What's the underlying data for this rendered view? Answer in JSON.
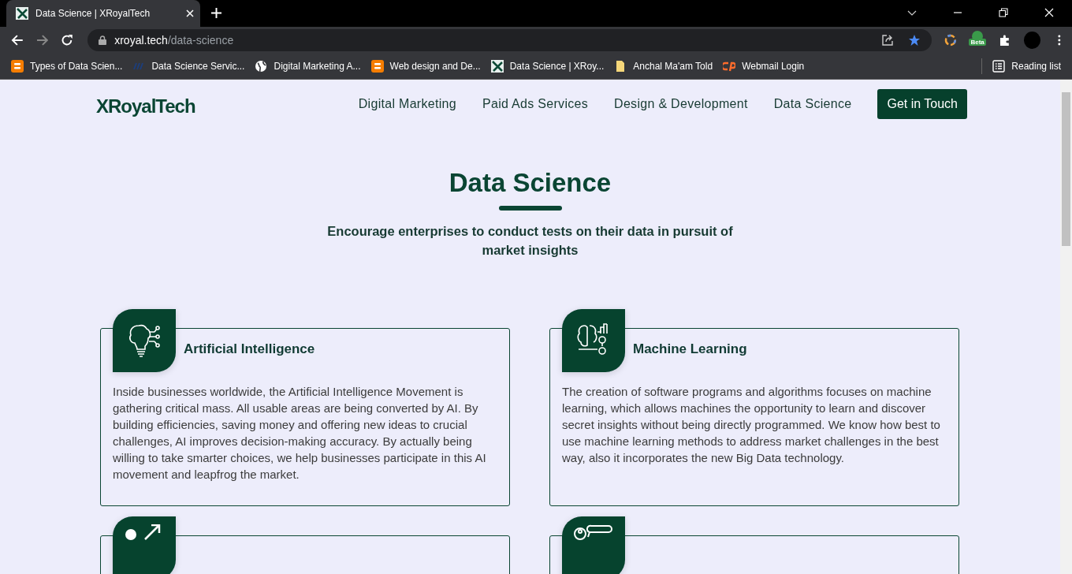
{
  "browser": {
    "tabs": [
      {
        "title": "Data Science | XRoyalTech",
        "selected": true
      }
    ],
    "address": {
      "host": "xroyal.tech",
      "path": "/data-science"
    },
    "bookmarks": [
      {
        "kind": "blogger",
        "label": "Types of Data Scien..."
      },
      {
        "kind": "dots",
        "label": "Data Science Servic..."
      },
      {
        "kind": "globe",
        "label": "Digital Marketing A..."
      },
      {
        "kind": "blogger",
        "label": "Web design and De..."
      },
      {
        "kind": "site",
        "label": "Data Science | XRoy..."
      },
      {
        "kind": "folder",
        "label": "Anchal Ma'am Told"
      },
      {
        "kind": "cpanel",
        "label": "Webmail Login"
      }
    ],
    "extension_badge": "Beta",
    "reading_list": "Reading list"
  },
  "header": {
    "logo": "XRoyalTech",
    "nav": [
      {
        "label": "Digital Marketing"
      },
      {
        "label": "Paid Ads Services"
      },
      {
        "label": "Design & Development"
      },
      {
        "label": "Data Science"
      }
    ],
    "cta": "Get in Touch"
  },
  "hero": {
    "title": "Data Science",
    "subtitle": "Encourage enterprises to conduct tests on their data in pursuit of market insights"
  },
  "cards": [
    {
      "kind": "ai",
      "title": "Artificial Intelligence",
      "text": "Inside businesses worldwide, the Artificial Intelligence Movement is gathering critical mass. All usable areas are being converted by AI. By building efficiencies, saving money and offering new ideas to crucial challenges, AI improves decision-making accuracy. By actually being willing to take smarter choices, we help businesses participate in this AI movement and leapfrog the market."
    },
    {
      "kind": "ml",
      "title": "Machine Learning",
      "text": "The creation of software programs and algorithms focuses on machine learning, which allows machines the opportunity to learn and discover secret insights without being directly programmed. We know how best to use machine learning methods to address market challenges in the best way, also it incorporates the new Big Data technology."
    },
    {
      "kind": "growth"
    },
    {
      "kind": "support"
    }
  ]
}
